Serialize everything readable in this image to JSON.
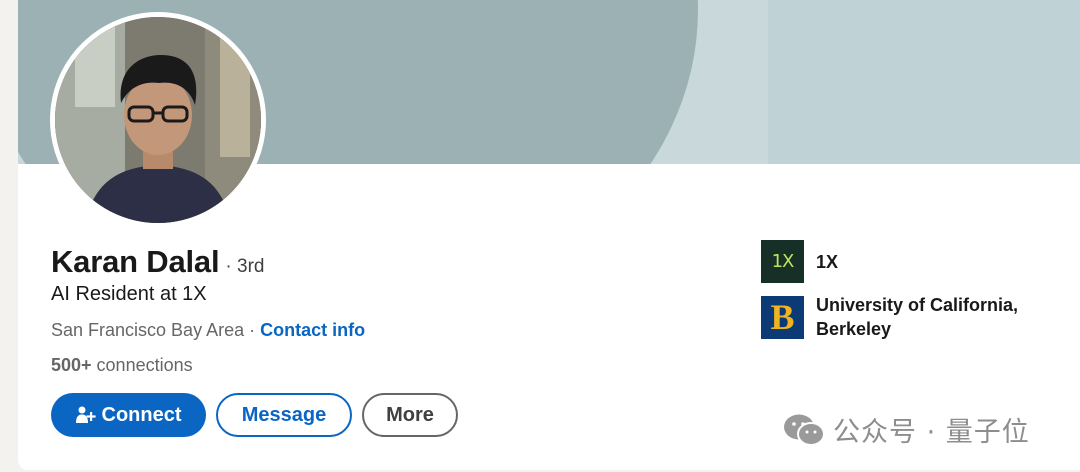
{
  "profile": {
    "name": "Karan Dalal",
    "degree": "· 3rd",
    "headline": "AI Resident at 1X",
    "location": "San Francisco Bay Area",
    "separator": " · ",
    "contact_info": "Contact info",
    "connections_count": "500+",
    "connections_label": " connections"
  },
  "actions": {
    "connect_label": "Connect",
    "message_label": "Message",
    "more_label": "More"
  },
  "organizations": [
    {
      "logo_text": "1X",
      "name": "1X",
      "logo_color": "#163028"
    },
    {
      "logo_text": "B",
      "name": "University of California, Berkeley",
      "logo_color": "#0b3a75"
    }
  ],
  "watermark": {
    "icon": "wechat-icon",
    "text": "公众号 · 量子位"
  },
  "colors": {
    "accent": "#0a66c2",
    "banner": "#9cb1b4"
  }
}
